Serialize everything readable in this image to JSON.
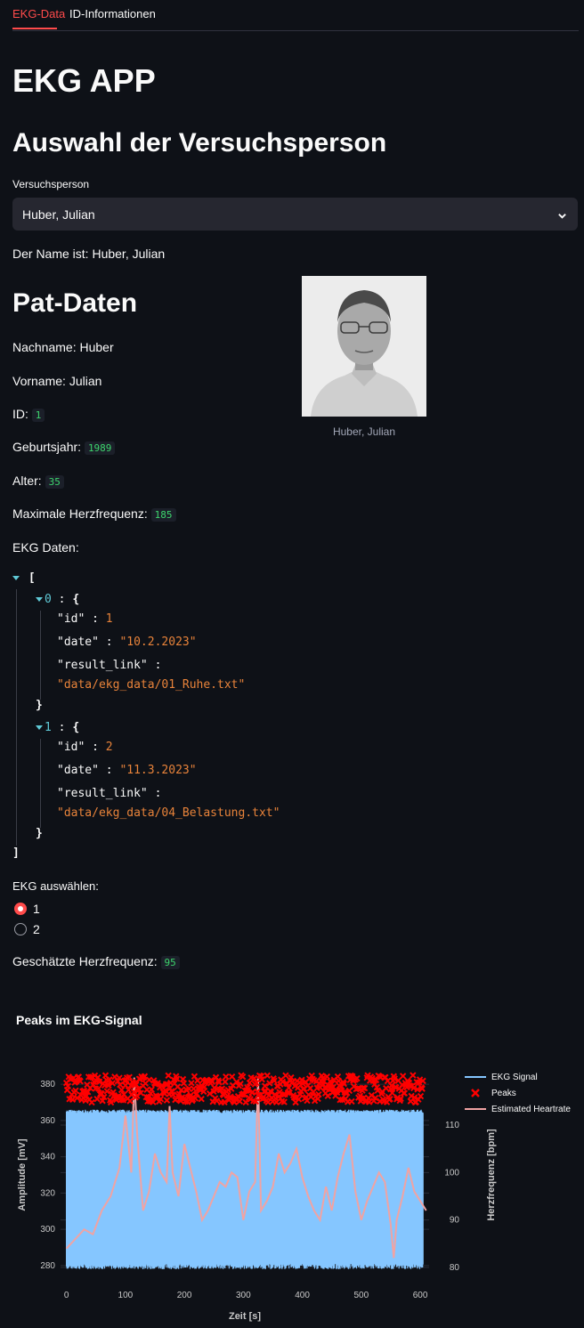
{
  "tabs": [
    "EKG-Data",
    "ID-Informationen"
  ],
  "app_title": "EKG APP",
  "section_select": "Auswahl der Versuchsperson",
  "select_label": "Versuchsperson",
  "select_value": "Huber, Julian",
  "name_line": "Der Name ist: Huber, Julian",
  "section_pat": "Pat-Daten",
  "lastname_line": "Nachname: Huber",
  "firstname_line": "Vorname: Julian",
  "id_label": "ID:",
  "id_value": "1",
  "birth_label": "Geburtsjahr:",
  "birth_value": "1989",
  "age_label": "Alter:",
  "age_value": "35",
  "maxhr_label": "Maximale Herzfrequenz:",
  "maxhr_value": "185",
  "ekg_label": "EKG Daten:",
  "photo_caption": "Huber, Julian",
  "ekg_entries": [
    {
      "index": "0",
      "id": "1",
      "date": "\"10.2.2023\"",
      "result_link": "\"data/ekg_data/01_Ruhe.txt\""
    },
    {
      "index": "1",
      "id": "2",
      "date": "\"11.3.2023\"",
      "result_link": "\"data/ekg_data/04_Belastung.txt\""
    }
  ],
  "json_keys": {
    "id": "\"id\"",
    "date": "\"date\"",
    "result_link": "\"result_link\""
  },
  "radio_label": "EKG auswählen:",
  "radio_options": [
    "1",
    "2"
  ],
  "radio_selected": "1",
  "hr_label": "Geschätzte Herzfrequenz:",
  "hr_value": "95",
  "chart_data": {
    "type": "line",
    "title": "Peaks im EKG-Signal",
    "xlabel": "Zeit [s]",
    "ylabel": "Amplitude [mV]",
    "y2label": "Herzfrequenz [bpm]",
    "xlim": [
      -10,
      615
    ],
    "ylim": [
      275,
      385
    ],
    "y2lim": [
      78.5,
      120.5
    ],
    "xticks": [
      0,
      100,
      200,
      300,
      400,
      500,
      600
    ],
    "yticks": [
      280,
      300,
      320,
      340,
      360,
      380
    ],
    "y2ticks": [
      80,
      90,
      100,
      110
    ],
    "legend_position": "top-right",
    "grid": true,
    "series": [
      {
        "name": "EKG Signal",
        "color": "#85c6ff",
        "axis": "y",
        "x_range": [
          0,
          605
        ],
        "y_low": 278,
        "y_high": 366
      },
      {
        "name": "Peaks",
        "color": "#ff0000",
        "axis": "y",
        "marker": "x",
        "x_range": [
          0,
          605
        ],
        "y_range": [
          370,
          385
        ]
      },
      {
        "name": "Estimated Heartrate",
        "color": "#f0a3a3",
        "axis": "y2",
        "x": [
          0,
          15,
          30,
          45,
          60,
          75,
          90,
          100,
          110,
          115,
          120,
          130,
          140,
          150,
          160,
          170,
          175,
          180,
          190,
          200,
          210,
          220,
          230,
          240,
          250,
          260,
          270,
          280,
          290,
          300,
          310,
          320,
          325,
          330,
          340,
          350,
          360,
          370,
          380,
          390,
          400,
          410,
          420,
          430,
          440,
          450,
          460,
          470,
          480,
          490,
          500,
          510,
          520,
          530,
          540,
          550,
          555,
          560,
          570,
          580,
          590,
          600,
          610
        ],
        "y": [
          84,
          86,
          88,
          87,
          92,
          95,
          101,
          112,
          100,
          120,
          108,
          92,
          96,
          104,
          100,
          98,
          114,
          100,
          95,
          106,
          101,
          96,
          90,
          92,
          95,
          98,
          97,
          100,
          99,
          90,
          96,
          98,
          120,
          92,
          94,
          97,
          104,
          100,
          102,
          105,
          99,
          95,
          92,
          90,
          97,
          92,
          99,
          104,
          108,
          96,
          90,
          94,
          97,
          100,
          98,
          89,
          82,
          90,
          95,
          101,
          96,
          94,
          92
        ]
      }
    ]
  }
}
